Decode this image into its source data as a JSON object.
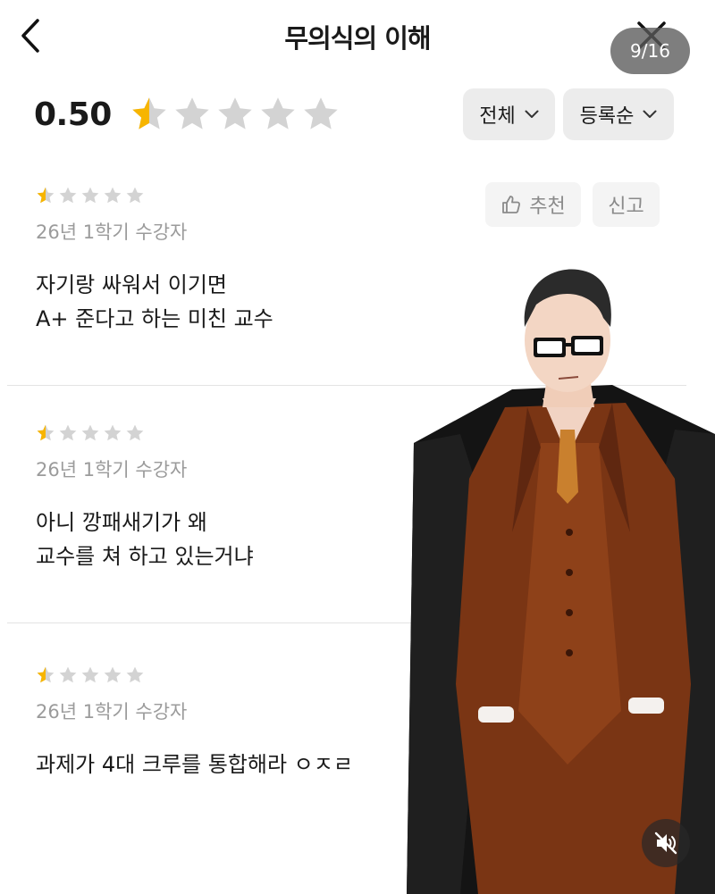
{
  "header": {
    "title": "무의식의 이해",
    "page_indicator": "9/16",
    "back_icon": "chevron-left-icon",
    "close_icon": "close-icon"
  },
  "summary": {
    "rating_value": "0.50",
    "rating_stars": 0.5,
    "max_stars": 5
  },
  "filters": {
    "all_label": "전체",
    "order_label": "등록순"
  },
  "actions": {
    "recommend_label": "추천",
    "report_label": "신고"
  },
  "reviews": [
    {
      "stars": 0.5,
      "meta": "26년 1학기 수강자",
      "lines": [
        "자기랑 싸워서 이기면",
        "A+ 준다고 하는 미친 교수"
      ]
    },
    {
      "stars": 0.5,
      "meta": "26년 1학기 수강자",
      "lines": [
        "아니 깡패새기가 왜",
        "교수를 쳐 하고 있는거냐"
      ]
    },
    {
      "stars": 0.5,
      "meta": "26년 1학기 수강자",
      "lines": [
        "과제가 4대 크루를 통합해라 ㅇㅈㄹ"
      ]
    }
  ],
  "colors": {
    "star_filled": "#f7b500",
    "star_empty": "#d3d3d3",
    "meta_text": "#9b9b9b",
    "filter_bg": "#ececec"
  },
  "media": {
    "mute_icon": "speaker-muted-icon"
  }
}
